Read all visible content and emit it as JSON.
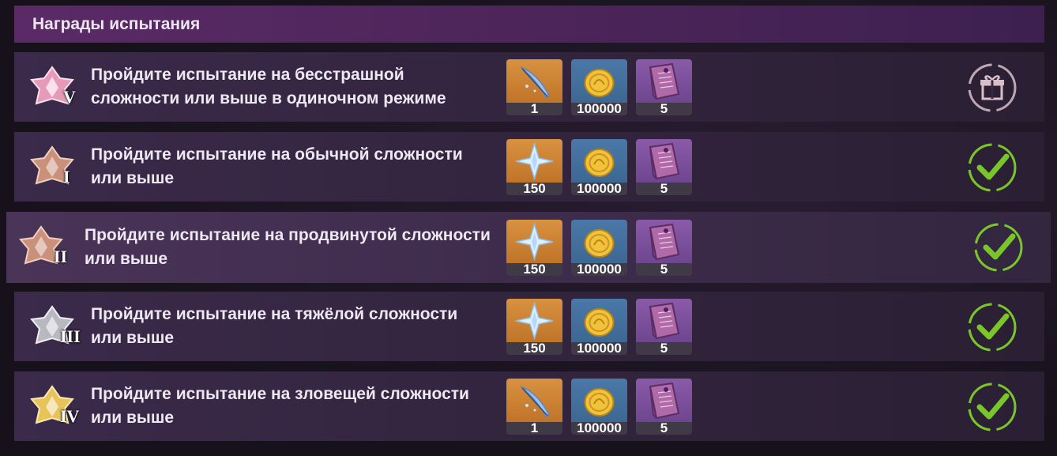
{
  "header": {
    "title": "Награды испытания"
  },
  "rows": [
    {
      "tier": "V",
      "badge_color": "#e79ab8",
      "text": "Пройдите испытание на бесстрашной сложности или выше в одиночном режиме",
      "rewards": [
        {
          "icon": "feather-icon",
          "count": "1"
        },
        {
          "icon": "mora-coin-icon",
          "count": "100000"
        },
        {
          "icon": "book-icon",
          "count": "5"
        }
      ],
      "status": "gift-icon"
    },
    {
      "tier": "I",
      "badge_color": "#c9907a",
      "text": "Пройдите испытание на обычной сложности или выше",
      "rewards": [
        {
          "icon": "primogem-icon",
          "count": "150"
        },
        {
          "icon": "mora-coin-icon",
          "count": "100000"
        },
        {
          "icon": "book-icon",
          "count": "5"
        }
      ],
      "status": "check-icon"
    },
    {
      "tier": "II",
      "badge_color": "#c9907a",
      "text": "Пройдите испытание на продвинутой сложности или выше",
      "rewards": [
        {
          "icon": "primogem-icon",
          "count": "150"
        },
        {
          "icon": "mora-coin-icon",
          "count": "100000"
        },
        {
          "icon": "book-icon",
          "count": "5"
        }
      ],
      "status": "check-icon"
    },
    {
      "tier": "III",
      "badge_color": "#b8b8c0",
      "text": "Пройдите испытание на тяжёлой сложности или выше",
      "rewards": [
        {
          "icon": "primogem-icon",
          "count": "150"
        },
        {
          "icon": "mora-coin-icon",
          "count": "100000"
        },
        {
          "icon": "book-icon",
          "count": "5"
        }
      ],
      "status": "check-icon"
    },
    {
      "tier": "IV",
      "badge_color": "#e8c35a",
      "text": "Пройдите испытание на зловещей сложности или выше",
      "rewards": [
        {
          "icon": "feather-icon",
          "count": "1"
        },
        {
          "icon": "mora-coin-icon",
          "count": "100000"
        },
        {
          "icon": "book-icon",
          "count": "5"
        }
      ],
      "status": "check-icon"
    }
  ],
  "colors": {
    "check": "#7ac62a",
    "gift": "#d9c0c8"
  }
}
